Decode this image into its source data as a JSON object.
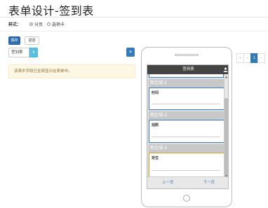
{
  "page": {
    "title": "表单设计-签到表"
  },
  "style_options": {
    "label": "样式：",
    "options": [
      {
        "label": "分页",
        "selected": true
      },
      {
        "label": "选项卡",
        "selected": false
      }
    ]
  },
  "toolbar": {
    "save_label": "保存",
    "back_label": "返回"
  },
  "form_select": {
    "value": "签到表",
    "arrow": "▾"
  },
  "add_button": {
    "label": "+"
  },
  "alert": {
    "text": "该表中字段已全部显示在表单中。"
  },
  "phone": {
    "header_title": "签到表",
    "scroll_up": "▲",
    "scroll_down": "▼",
    "sections": [
      {
        "title": "新区域-2",
        "field": "时间",
        "highlight": "blue"
      },
      {
        "title": "新区域-3",
        "field": "拍照",
        "highlight": "blue"
      },
      {
        "title": "新区域-4",
        "field": "定位",
        "highlight": "orange"
      }
    ],
    "prev_label": "上一页",
    "next_label": "下一页"
  },
  "pagination": {
    "prev": "«",
    "prev_one": "‹",
    "current": "1",
    "next": "›"
  },
  "colors": {
    "primary": "#337ab7",
    "info": "#5bc0de",
    "alert_bg": "#fcf8e3",
    "alert_text": "#8a6d3b",
    "selected_border": "#3d7ec0",
    "active_border": "#e0a12a"
  }
}
